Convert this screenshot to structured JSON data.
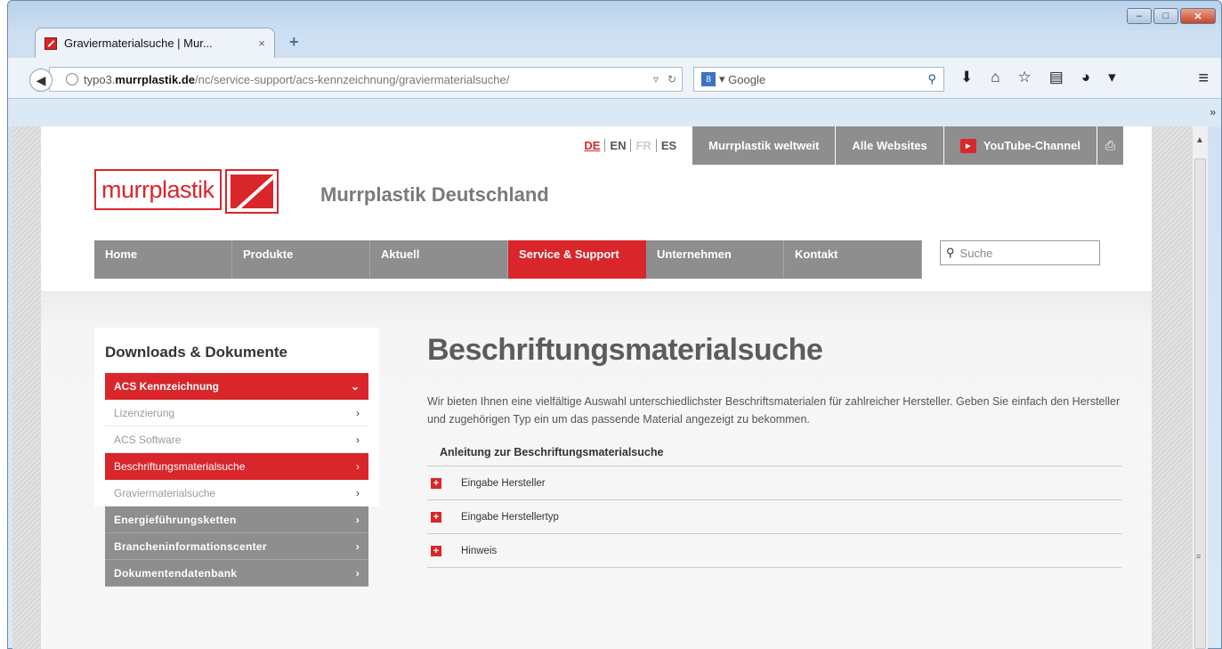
{
  "browser": {
    "tab_title": "Graviermaterialsuche | Mur...",
    "tab_close": "×",
    "new_tab": "+",
    "url_host_prefix": "typo3.",
    "url_host_domain": "murrplastik.de",
    "url_path": "/nc/service-support/acs-kennzeichnung/graviermaterialsuche/",
    "search_engine_badge": "8",
    "search_placeholder": "Google",
    "overflow_chevron": "»",
    "window_buttons": {
      "minimize": "–",
      "maximize": "□",
      "close": "✕"
    }
  },
  "topbar": {
    "languages": [
      "DE",
      "EN",
      "FR",
      "ES"
    ],
    "links": [
      "Murrplastik weltweit",
      "Alle Websites",
      "YouTube-Channel"
    ]
  },
  "brand": {
    "logo_text": "murrplastik",
    "site_title": "Murrplastik Deutschland",
    "accent_color": "#d9262b"
  },
  "mainnav": {
    "items": [
      "Home",
      "Produkte",
      "Aktuell",
      "Service & Support",
      "Unternehmen",
      "Kontakt"
    ],
    "active_index": 3,
    "search_placeholder": "Suche"
  },
  "sidebar": {
    "heading": "Downloads & Dokumente",
    "section_active": "ACS Kennzeichnung",
    "sub_items": [
      {
        "label": "Lizenzierung"
      },
      {
        "label": "ACS Software"
      },
      {
        "label": "Beschriftungsmaterialsuche"
      },
      {
        "label": "Graviermaterialsuche"
      }
    ],
    "sub_active_index": 2,
    "sections": [
      "Energieführungsketten",
      "Brancheninformationscenter",
      "Dokumentendatenbank"
    ]
  },
  "content": {
    "title": "Beschriftungsmaterialsuche",
    "intro": "Wir bieten Ihnen eine vielfältige Auswahl unterschiedlichster Beschriftsmaterialen für zahlreicher Hersteller. Geben Sie einfach den Hersteller und zugehörigen Typ ein um das passende Material angezeigt zu bekommen.",
    "accordion_title": "Anleitung zur Beschriftungsmaterialsuche",
    "accordion_items": [
      "Eingabe Hersteller",
      "Eingabe Herstellertyp",
      "Hinweis"
    ]
  }
}
